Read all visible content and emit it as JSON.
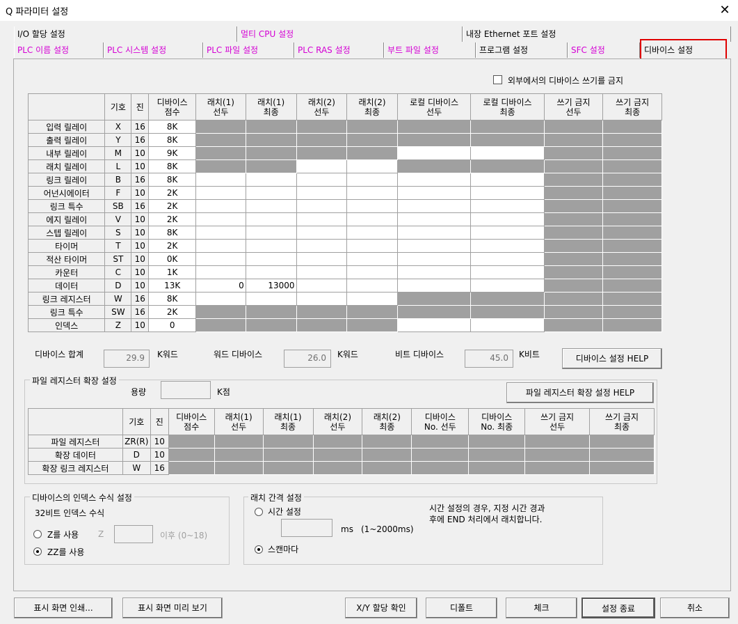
{
  "window": {
    "title": "Q 파라미터 설정",
    "close": "✕"
  },
  "tabs": {
    "row1": [
      "I/O 할당 설정",
      "멀티 CPU 설정",
      "내장 Ethernet 포트 설정"
    ],
    "row2": [
      "PLC 이름 설정",
      "PLC 시스템 설정",
      "PLC 파일 설정",
      "PLC RAS 설정",
      "부트 파일 설정",
      "프로그램 설정",
      "SFC 설정",
      "디바이스 설정"
    ],
    "active": "디바이스 설정",
    "active_highlight_color": "#e00000"
  },
  "options": {
    "forbid_external_write": "외부에서의 디바이스 쓰기를 금지",
    "forbid_external_write_checked": false
  },
  "device_table": {
    "headers": [
      "",
      "기호",
      "진",
      "디바이스\n점수",
      "래치(1)\n선두",
      "래치(1)\n최종",
      "래치(2)\n선두",
      "래치(2)\n최종",
      "로컬 디바이스\n선두",
      "로컬 디바이스\n최종",
      "쓰기 금지\n선두",
      "쓰기 금지\n최종"
    ],
    "rows": [
      {
        "name": "입력 릴레이",
        "sym": "X",
        "base": "16",
        "points": "8K",
        "l1s": "",
        "l1e": ""
      },
      {
        "name": "출력 릴레이",
        "sym": "Y",
        "base": "16",
        "points": "8K",
        "l1s": "",
        "l1e": ""
      },
      {
        "name": "내부 릴레이",
        "sym": "M",
        "base": "10",
        "points": "9K",
        "l1s": "",
        "l1e": ""
      },
      {
        "name": "래치 릴레이",
        "sym": "L",
        "base": "10",
        "points": "8K",
        "l1s": "",
        "l1e": ""
      },
      {
        "name": "링크 릴레이",
        "sym": "B",
        "base": "16",
        "points": "8K",
        "l1s": "",
        "l1e": ""
      },
      {
        "name": "어넌시에이터",
        "sym": "F",
        "base": "10",
        "points": "2K",
        "l1s": "",
        "l1e": ""
      },
      {
        "name": "링크 특수",
        "sym": "SB",
        "base": "16",
        "points": "2K",
        "l1s": "",
        "l1e": ""
      },
      {
        "name": "에지 릴레이",
        "sym": "V",
        "base": "10",
        "points": "2K",
        "l1s": "",
        "l1e": ""
      },
      {
        "name": "스텝 릴레이",
        "sym": "S",
        "base": "10",
        "points": "8K",
        "l1s": "",
        "l1e": ""
      },
      {
        "name": "타이머",
        "sym": "T",
        "base": "10",
        "points": "2K",
        "l1s": "",
        "l1e": ""
      },
      {
        "name": "적산 타이머",
        "sym": "ST",
        "base": "10",
        "points": "0K",
        "l1s": "",
        "l1e": ""
      },
      {
        "name": "카운터",
        "sym": "C",
        "base": "10",
        "points": "1K",
        "l1s": "",
        "l1e": ""
      },
      {
        "name": "데이터",
        "sym": "D",
        "base": "10",
        "points": "13K",
        "l1s": "0",
        "l1e": "13000"
      },
      {
        "name": "링크 레지스터",
        "sym": "W",
        "base": "16",
        "points": "8K",
        "l1s": "",
        "l1e": ""
      },
      {
        "name": "링크 특수",
        "sym": "SW",
        "base": "16",
        "points": "2K",
        "l1s": "",
        "l1e": ""
      },
      {
        "name": "인덱스",
        "sym": "Z",
        "base": "10",
        "points": "0",
        "l1s": "",
        "l1e": ""
      }
    ]
  },
  "totals": {
    "total_label": "디바이스 합계",
    "total": "29.9",
    "total_unit": "K워드",
    "word_label": "워드 디바이스",
    "word": "26.0",
    "word_unit": "K워드",
    "bit_label": "비트 디바이스",
    "bit": "45.0",
    "bit_unit": "K비트",
    "help": "디바이스 설정 HELP"
  },
  "file_register": {
    "group": "파일 레지스터 확장 설정",
    "capacity_label": "용량",
    "capacity_unit": "K점",
    "help": "파일 레지스터 확장 설정 HELP",
    "headers": [
      "",
      "기호",
      "진",
      "디바이스\n점수",
      "래치(1)\n선두",
      "래치(1)\n최종",
      "래치(2)\n선두",
      "래치(2)\n최종",
      "디바이스\nNo. 선두",
      "디바이스\nNo. 최종",
      "쓰기 금지\n선두",
      "쓰기 금지\n최종"
    ],
    "rows": [
      {
        "name": "파일 레지스터",
        "sym": "ZR(R)",
        "base": "10"
      },
      {
        "name": "확장 데이터",
        "sym": "D",
        "base": "10"
      },
      {
        "name": "확장 링크 레지스터",
        "sym": "W",
        "base": "16"
      }
    ]
  },
  "index_mod": {
    "group": "디바이스의 인덱스 수식 설정",
    "label32": "32비트 인덱스 수식",
    "use_z": "Z를 사용",
    "z_prefix": "Z",
    "z_suffix": "이후 (0~18)",
    "use_zz": "ZZ를 사용",
    "selected": "zz"
  },
  "latch": {
    "group": "래치 간격 설정",
    "time": "시간 설정",
    "ms": "ms",
    "range": "(1~2000ms)",
    "scan": "스캔마다",
    "note": "시간 설정의 경우, 지정 시간 경과\n후에 END 처리에서 래치합니다.",
    "selected": "scan"
  },
  "buttons": {
    "print": "표시 화면 인쇄...",
    "preview": "표시 화면 미리 보기",
    "xy": "X/Y 할당 확인",
    "default": "디폴트",
    "check": "체크",
    "finish": "설정 종료",
    "cancel": "취소"
  }
}
